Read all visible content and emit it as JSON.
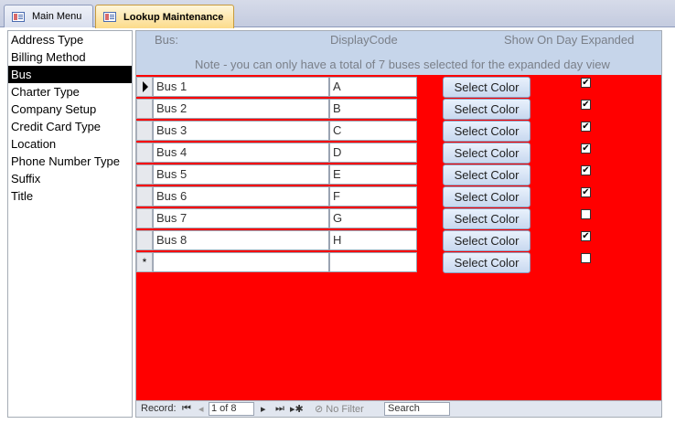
{
  "tabs": [
    {
      "label": "Main Menu",
      "icon": "form-icon",
      "active": false
    },
    {
      "label": "Lookup Maintenance",
      "icon": "form-icon",
      "active": true
    }
  ],
  "lookup_list": {
    "items": [
      "Address Type",
      "Billing Method",
      "Bus",
      "Charter Type",
      "Company Setup",
      "Credit Card Type",
      "Location",
      "Phone Number Type",
      "Suffix",
      "Title"
    ],
    "selected": "Bus"
  },
  "subform": {
    "header": {
      "bus_label": "Bus:",
      "display_code_label": "DisplayCode",
      "show_expanded_label": "Show On Day Expanded",
      "note": "Note - you can only have a total of 7 buses selected for the expanded day view"
    },
    "detail_color": "#ff0000",
    "button_label": "Select Color",
    "new_record_marker": "*",
    "rows": [
      {
        "bus": "Bus 1",
        "code": "A",
        "show": true
      },
      {
        "bus": "Bus 2",
        "code": "B",
        "show": true
      },
      {
        "bus": "Bus 3",
        "code": "C",
        "show": true
      },
      {
        "bus": "Bus 4",
        "code": "D",
        "show": true
      },
      {
        "bus": "Bus 5",
        "code": "E",
        "show": true
      },
      {
        "bus": "Bus 6",
        "code": "F",
        "show": true
      },
      {
        "bus": "Bus 7",
        "code": "G",
        "show": false
      },
      {
        "bus": "Bus 8",
        "code": "H",
        "show": true
      },
      {
        "bus": "",
        "code": "",
        "show": false
      }
    ]
  },
  "navigation": {
    "record_label": "Record:",
    "position": "1 of 8",
    "filter_label": "No Filter",
    "search_placeholder": "Search"
  }
}
